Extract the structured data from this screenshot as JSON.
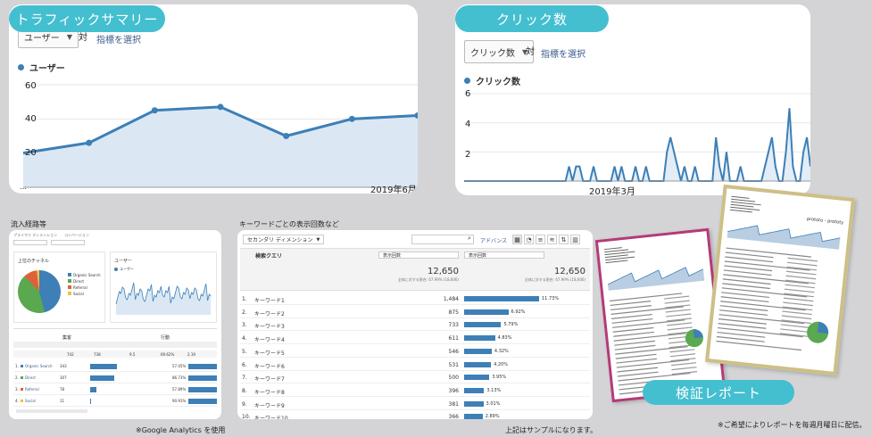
{
  "traffic": {
    "badge": "トラフィックサマリー",
    "metric": "ユーザー",
    "vs": "対",
    "select_metric": "指標を選択",
    "legend": "ユーザー",
    "y_ticks": [
      "60",
      "40",
      "20"
    ],
    "x_tick": "2019年6月",
    "dots": "…"
  },
  "clicks": {
    "badge": "クリック数",
    "metric": "クリック数",
    "vs": "対",
    "select_metric": "指標を選択",
    "legend": "クリック数",
    "y_ticks": [
      "6",
      "4",
      "2"
    ],
    "x_tick": "2019年3月"
  },
  "channels": {
    "caption": "流入経路等",
    "tabs": [
      "プライマリ ディメンション",
      "コンバージョン"
    ],
    "pie_title": "上位のチャネル",
    "legend": [
      {
        "label": "Organic Search",
        "color": "#3d7fb6"
      },
      {
        "label": "Direct",
        "color": "#5aa850"
      },
      {
        "label": "Referral",
        "color": "#e0603c"
      },
      {
        "label": "Social",
        "color": "#f0c23c"
      }
    ],
    "line_title": "ユーザー",
    "line_legend": "ユーザー",
    "groups": [
      "集客",
      "行動"
    ],
    "total": [
      "742",
      "738",
      "9.5",
      "69.62%",
      "2.19"
    ],
    "rows": [
      {
        "n": "1.",
        "name": "Organic Search",
        "v": "343",
        "c": "#3d7fb6"
      },
      {
        "n": "2.",
        "name": "Direct",
        "v": "307",
        "c": "#5aa850"
      },
      {
        "n": "3.",
        "name": "Referral",
        "v": "78",
        "c": "#e0603c"
      },
      {
        "n": "4.",
        "name": "Social",
        "v": "11",
        "c": "#f0c23c"
      }
    ],
    "rates": [
      "57.45%",
      "86.73%",
      "57.89%",
      "90.91%"
    ],
    "footnote": "※Google Analytics を使用"
  },
  "keywords": {
    "caption": "キーワードごとの表示回数など",
    "secondary_dim": "セカンダリ ディメンション",
    "advanced": "アドバンス",
    "col_query": "検索クエリ",
    "col_sel": "表示回数",
    "total": "12,650",
    "total_note": "全体に対する割合: 67.99% (18,606)",
    "rows": [
      {
        "n": "1.",
        "name": "キーワード1",
        "v": "1,484",
        "p": "11.73%",
        "f": 11.73
      },
      {
        "n": "2.",
        "name": "キーワード2",
        "v": "875",
        "p": "6.92%",
        "f": 6.92
      },
      {
        "n": "3.",
        "name": "キーワード3",
        "v": "733",
        "p": "5.79%",
        "f": 5.79
      },
      {
        "n": "4.",
        "name": "キーワード4",
        "v": "611",
        "p": "4.83%",
        "f": 4.83
      },
      {
        "n": "5.",
        "name": "キーワード5",
        "v": "546",
        "p": "4.32%",
        "f": 4.32
      },
      {
        "n": "6.",
        "name": "キーワード6",
        "v": "531",
        "p": "4.20%",
        "f": 4.2
      },
      {
        "n": "7.",
        "name": "キーワード7",
        "v": "500",
        "p": "3.95%",
        "f": 3.95
      },
      {
        "n": "8.",
        "name": "キーワード8",
        "v": "396",
        "p": "3.13%",
        "f": 3.13
      },
      {
        "n": "9.",
        "name": "キーワード9",
        "v": "381",
        "p": "3.01%",
        "f": 3.01
      },
      {
        "n": "10.",
        "name": "キーワード10",
        "v": "366",
        "p": "2.89%",
        "f": 2.89
      }
    ],
    "footnote": "上記はサンプルになります。"
  },
  "report": {
    "badge": "検証レポート",
    "doc_title": "prototo - prototy",
    "footnote": "※ご希望によりレポートを毎週月曜日に配信。",
    "colors": {
      "pink": "#b43a78",
      "gold": "#cdbf86"
    }
  },
  "chart_data": [
    {
      "type": "area",
      "title": "",
      "series": [
        {
          "name": "ユーザー",
          "values": [
            20,
            26,
            45,
            47,
            30,
            40,
            42
          ]
        }
      ],
      "ylim": [
        0,
        60
      ],
      "y_ticks": [
        20,
        40,
        60
      ],
      "x_label_shown": "2019年6月"
    },
    {
      "type": "line",
      "title": "",
      "series": [
        {
          "name": "クリック数",
          "values": [
            0,
            0,
            0,
            0,
            0,
            0,
            0,
            0,
            0,
            0,
            0,
            0,
            0,
            0,
            0,
            0,
            0,
            0,
            0,
            0,
            0,
            0,
            0,
            0,
            0,
            0,
            0,
            0,
            0,
            0,
            1,
            0,
            1,
            1,
            0,
            0,
            0,
            1,
            0,
            0,
            0,
            0,
            0,
            1,
            0,
            1,
            0,
            0,
            0,
            1,
            0,
            0,
            1,
            0,
            0,
            0,
            0,
            0,
            2,
            3,
            2,
            1,
            0,
            1,
            0,
            0,
            1,
            0,
            0,
            0,
            0,
            0,
            3,
            1,
            0,
            2,
            0,
            0,
            0,
            1,
            0,
            0,
            0,
            0,
            0,
            0,
            1,
            2,
            3,
            1,
            0,
            0,
            2,
            5,
            1,
            0,
            0,
            2,
            3,
            1
          ]
        }
      ],
      "ylim": [
        0,
        6
      ],
      "y_ticks": [
        2,
        4,
        6
      ],
      "x_label_shown": "2019年3月"
    },
    {
      "type": "bar",
      "title": "",
      "categories": [
        "キーワード1",
        "キーワード2",
        "キーワード3",
        "キーワード4",
        "キーワード5",
        "キーワード6",
        "キーワード7",
        "キーワード8",
        "キーワード9",
        "キーワード10"
      ],
      "values": [
        1484,
        875,
        733,
        611,
        546,
        531,
        500,
        396,
        381,
        366
      ]
    }
  ]
}
